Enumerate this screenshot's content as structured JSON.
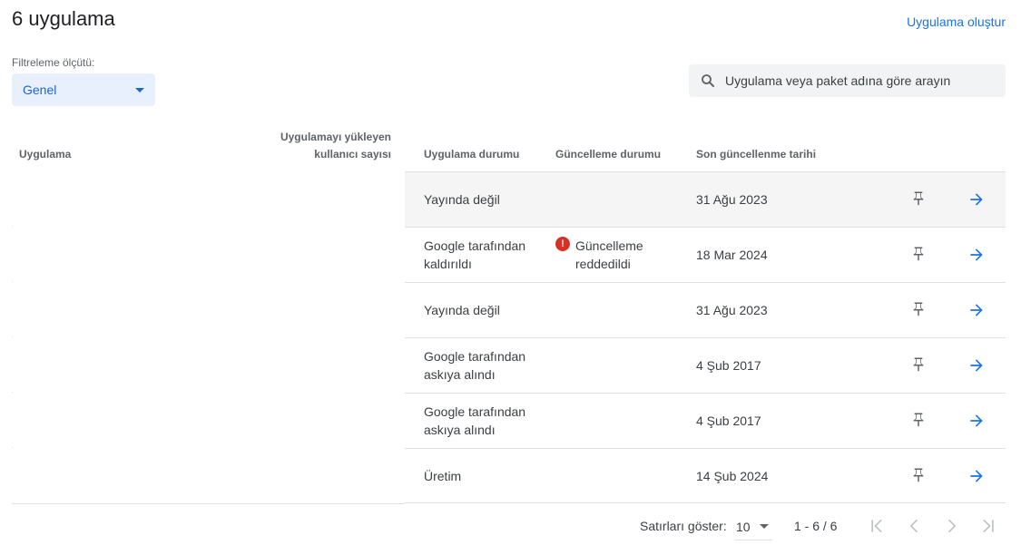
{
  "header": {
    "title": "6 uygulama",
    "create_link": "Uygulama oluştur"
  },
  "filter": {
    "label": "Filtreleme ölçütü:",
    "selected": "Genel"
  },
  "search": {
    "placeholder": "Uygulama veya paket adına göre arayın"
  },
  "table": {
    "columns": {
      "app": "Uygulama",
      "users": "Uygulamayı yükleyen kullanıcı sayısı",
      "app_status": "Uygulama durumu",
      "update_status": "Güncelleme durumu",
      "last_updated": "Son güncellenme tarihi"
    },
    "rows": [
      {
        "app_status": "Yayında değil",
        "update_status": "",
        "last_updated": "31 Ağu 2023"
      },
      {
        "app_status": "Google tarafından kaldırıldı",
        "update_status": "Güncelleme reddedildi",
        "last_updated": "18 Mar 2024"
      },
      {
        "app_status": "Yayında değil",
        "update_status": "",
        "last_updated": "31 Ağu 2023"
      },
      {
        "app_status": "Google tarafından askıya alındı",
        "update_status": "",
        "last_updated": "4 Şub 2017"
      },
      {
        "app_status": "Google tarafından askıya alındı",
        "update_status": "",
        "last_updated": "4 Şub 2017"
      },
      {
        "app_status": "Üretim",
        "update_status": "",
        "last_updated": "14 Şub 2024"
      }
    ]
  },
  "pagination": {
    "rows_label": "Satırları göster:",
    "rows_per_page": "10",
    "range": "1 - 6 / 6"
  },
  "icons": {
    "search": "search-icon",
    "pin": "pin-icon",
    "arrow": "arrow-forward-icon",
    "error": "error-icon",
    "first": "first-page-icon",
    "prev": "chevron-left-icon",
    "next": "chevron-right-icon",
    "last": "last-page-icon"
  },
  "colors": {
    "accent": "#1a73e8",
    "error": "#d93025",
    "filter_bg": "#e8f0fe"
  }
}
